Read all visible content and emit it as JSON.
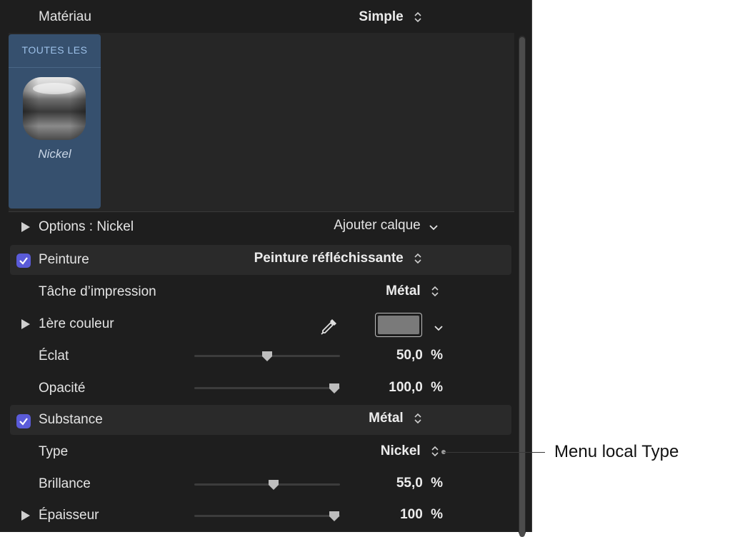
{
  "header": {
    "label": "Matériau",
    "value": "Simple"
  },
  "browser": {
    "category": "TOUTES LES",
    "item_name": "Nickel"
  },
  "options": {
    "label": "Options : Nickel",
    "add_layer": "Ajouter calque"
  },
  "paint": {
    "label": "Peinture",
    "value": "Peinture réfléchissante",
    "checked": true,
    "rows": {
      "task": {
        "label": "Tâche d’impression",
        "value": "Métal"
      },
      "color1": {
        "label": "1ère couleur",
        "swatch_color": "#7a7a7a"
      },
      "eclat": {
        "label": "Éclat",
        "value": "50,0",
        "unit": "%",
        "level": 0.5
      },
      "opacity": {
        "label": "Opacité",
        "value": "100,0",
        "unit": "%",
        "level": 1.0
      }
    }
  },
  "substance": {
    "label": "Substance",
    "value": "Métal",
    "checked": true,
    "rows": {
      "type": {
        "label": "Type",
        "value": "Nickel"
      },
      "brillance": {
        "label": "Brillance",
        "value": "55,0",
        "unit": "%",
        "level": 0.55
      },
      "epaisseur": {
        "label": "Épaisseur",
        "value": "100",
        "unit": "%",
        "level": 1.0
      }
    }
  },
  "callout": {
    "text": "Menu local Type"
  },
  "colors": {
    "panel_bg": "#1e1e1e",
    "tile_bg": "#36506e",
    "checkbox_accent": "#5a5bd9"
  },
  "icons": {
    "eyedropper": "eyedropper-icon",
    "stepper": "up-down-chevron-icon",
    "chevron_down": "chevron-down-icon",
    "disclosure": "disclosure-triangle-icon"
  }
}
